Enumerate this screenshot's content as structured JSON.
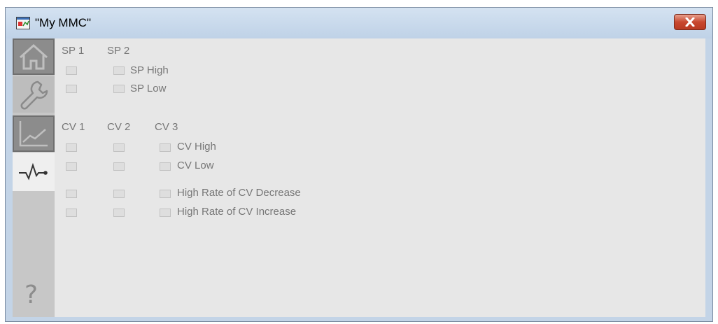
{
  "window": {
    "title": "\"My MMC\""
  },
  "nav": {
    "items": [
      {
        "icon": "home-icon"
      },
      {
        "icon": "wrench-icon"
      },
      {
        "icon": "trend-icon"
      },
      {
        "icon": "alarm-pulse-icon"
      },
      {
        "icon": "help-icon",
        "label": "?"
      }
    ]
  },
  "sp": {
    "col1": "SP 1",
    "col2": "SP 2",
    "rows": [
      "SP High",
      "SP Low"
    ]
  },
  "cv": {
    "col1": "CV 1",
    "col2": "CV 2",
    "col3": "CV 3",
    "rows": [
      "CV High",
      "CV Low",
      "High Rate of CV Decrease",
      "High Rate of CV Increase"
    ]
  }
}
